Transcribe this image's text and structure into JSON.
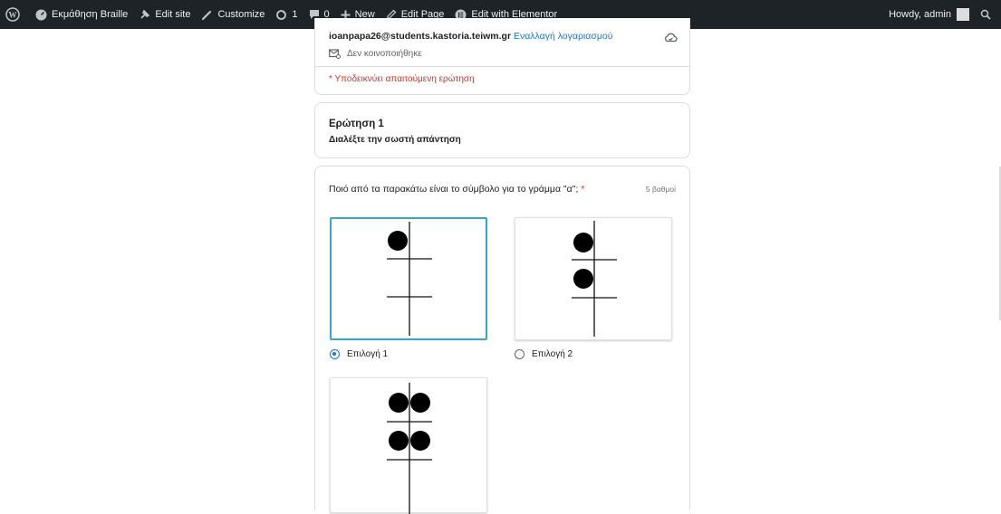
{
  "adminbar": {
    "items": [
      "Εκμάθηση Braille",
      "Edit site",
      "Customize",
      "1",
      "0",
      "New",
      "Edit Page",
      "Edit with Elementor"
    ],
    "greeting": "Howdy, admin"
  },
  "account": {
    "email": "ioanpapa26@students.kastoria.teiwm.gr",
    "switch_link": "Εναλλαγή λογαριασμού",
    "not_shared": "Δεν κοινοποιήθηκε",
    "required_note": "* Υποδεικνύει απαιτούμενη ερώτηση"
  },
  "section": {
    "title": "Ερώτηση 1",
    "description": "Διαλέξτε την σωστή απάντηση"
  },
  "question": {
    "text": "Ποιό από τα παρακάτω είναι το σύμβολο για το γράμμα  \"α\";",
    "required_mark": "*",
    "points": "5 βαθμοί",
    "options": [
      {
        "label": "Επιλογή 1",
        "selected": true,
        "dots": [
          1
        ]
      },
      {
        "label": "Επιλογή 2",
        "selected": false,
        "dots": [
          1,
          2
        ]
      },
      {
        "label": "",
        "selected": false,
        "dots": [
          1,
          2,
          4,
          5
        ]
      }
    ]
  },
  "colors": {
    "adminbar": "#1d2327",
    "accent_blue": "#1a73e8",
    "required_red": "#d93025",
    "selected_border": "#34a8c8"
  }
}
